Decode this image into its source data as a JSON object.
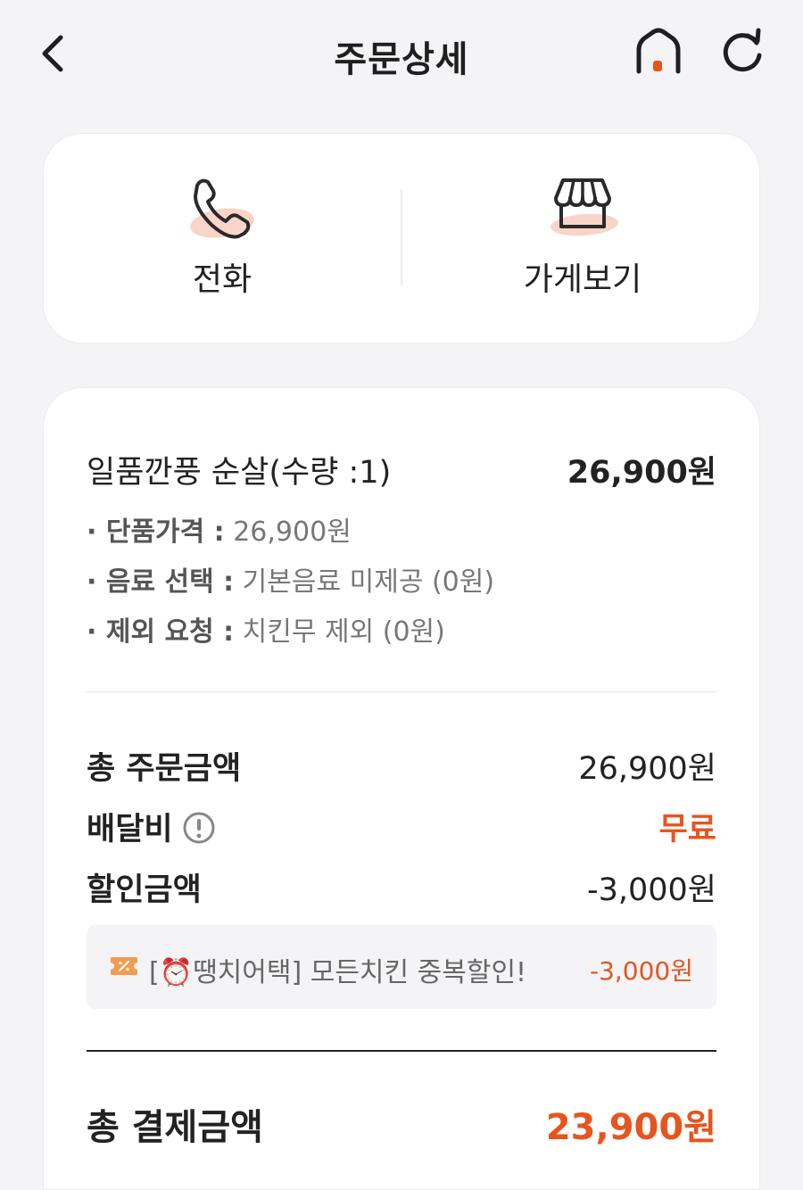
{
  "header": {
    "title": "주문상세"
  },
  "actions": {
    "call_label": "전화",
    "store_label": "가게보기"
  },
  "item": {
    "name": "일품깐풍 순살(수량 :1)",
    "price": "26,900원",
    "options": [
      {
        "key": "· 단품가격 :",
        "value": " 26,900원"
      },
      {
        "key": "· 음료 선택 :",
        "value": " 기본음료 미제공 (0원)"
      },
      {
        "key": "· 제외 요청 :",
        "value": " 치킨무 제외 (0원)"
      }
    ]
  },
  "summary": {
    "total_order_label": "총 주문금액",
    "total_order_value": "26,900원",
    "delivery_label": "배달비",
    "delivery_value": "무료",
    "discount_label": "할인금액",
    "discount_value": "-3,000원"
  },
  "coupon": {
    "text_prefix": "[",
    "emoji": "⏰",
    "text_rest": "땡치어택] 모든치킨 중복할인!",
    "amount": "-3,000원"
  },
  "payment": {
    "label": "총 결제금액",
    "value": "23,900원"
  },
  "colors": {
    "accent": "#e8541e",
    "background": "#f4f4f6",
    "card": "#ffffff",
    "icon_blush": "#f9d4c8"
  },
  "icons": {
    "back": "chevron-left",
    "home": "home-with-orange-dot",
    "refresh": "circular-arrow",
    "call": "phone-handset",
    "store": "storefront-awning",
    "info": "exclamation-circle",
    "coupon": "percent-ticket"
  }
}
